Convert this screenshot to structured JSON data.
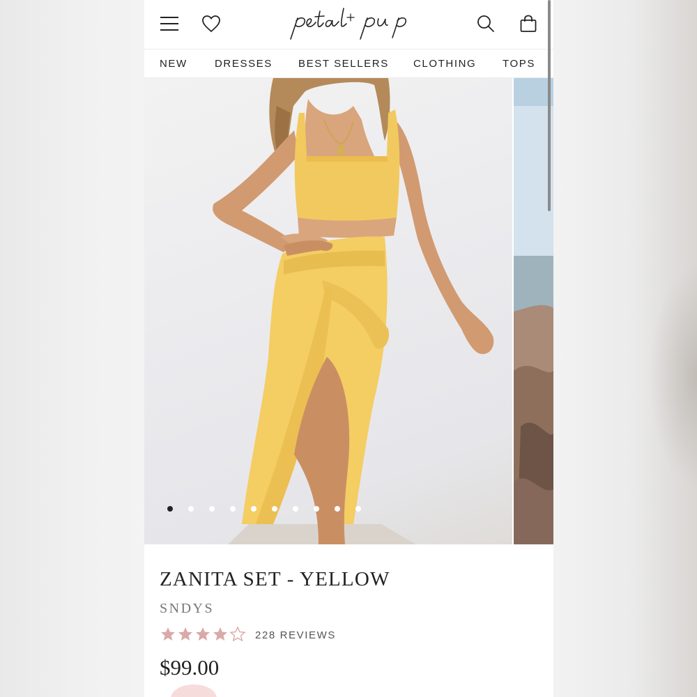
{
  "header": {
    "logo_text": "petal + pup",
    "icons": [
      "menu-icon",
      "heart-icon",
      "search-icon",
      "bag-icon"
    ]
  },
  "nav": {
    "items": [
      {
        "label": "NEW"
      },
      {
        "label": "DRESSES"
      },
      {
        "label": "BEST SELLERS"
      },
      {
        "label": "CLOTHING"
      },
      {
        "label": "TOPS"
      }
    ]
  },
  "gallery": {
    "image_count": 10,
    "active_index": 0
  },
  "product": {
    "title": "ZANITA SET - YELLOW",
    "brand": "SNDYS",
    "rating": 4,
    "rating_max": 5,
    "reviews_label": "228 REVIEWS",
    "price": "$99.00"
  },
  "colors": {
    "star_filled": "#d9aaa8",
    "star_empty": "#d9aaa8",
    "product_yellow": "#f2c95e",
    "text_dark": "#222222"
  }
}
